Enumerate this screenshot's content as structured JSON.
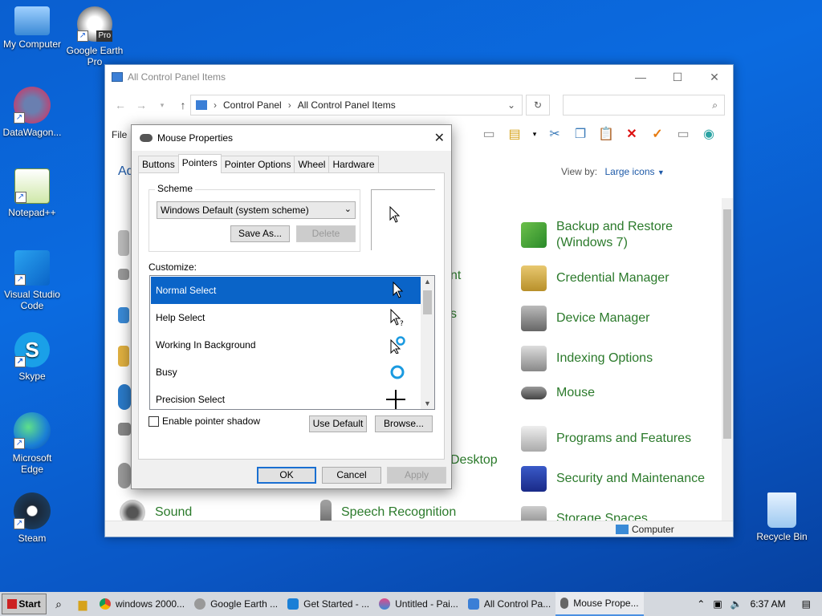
{
  "desktop": {
    "icons": [
      {
        "label": "My Computer"
      },
      {
        "label": "Google Earth Pro"
      },
      {
        "label": "DataWagon..."
      },
      {
        "label": "Notepad++"
      },
      {
        "label": "Visual Studio Code"
      },
      {
        "label": "Skype"
      },
      {
        "label": "Microsoft Edge"
      },
      {
        "label": "Steam"
      },
      {
        "label": "Recycle Bin"
      }
    ],
    "google_earth_badge": "Pro"
  },
  "control_panel": {
    "title": "All Control Panel Items",
    "breadcrumb": [
      "Control Panel",
      "All Control Panel Items"
    ],
    "menu_file": "File",
    "heading_partial": "Ad",
    "view_by_label": "View by:",
    "view_by_value": "Large icons",
    "items_partial": [
      {
        "label": "nt"
      },
      {
        "label": "Desktop"
      },
      {
        "label": "Sound"
      },
      {
        "label": "Speech Recognition"
      }
    ],
    "items": [
      {
        "label": "Backup and Restore (Windows 7)"
      },
      {
        "label": "Credential Manager"
      },
      {
        "label": "Device Manager"
      },
      {
        "label": "Indexing Options"
      },
      {
        "label": "Mouse"
      },
      {
        "label": "Programs and Features"
      },
      {
        "label": "Security and Maintenance"
      },
      {
        "label": "Storage Spaces"
      }
    ],
    "status_computer": "Computer"
  },
  "mouse_dialog": {
    "title": "Mouse Properties",
    "tabs": [
      "Buttons",
      "Pointers",
      "Pointer Options",
      "Wheel",
      "Hardware"
    ],
    "active_tab": "Pointers",
    "scheme_label": "Scheme",
    "scheme_value": "Windows Default (system scheme)",
    "save_as": "Save As...",
    "delete": "Delete",
    "customize_label": "Customize:",
    "pointers": [
      {
        "label": "Normal Select"
      },
      {
        "label": "Help Select"
      },
      {
        "label": "Working In Background"
      },
      {
        "label": "Busy"
      },
      {
        "label": "Precision Select"
      }
    ],
    "selected_pointer": "Normal Select",
    "enable_shadow": "Enable pointer shadow",
    "use_default": "Use Default",
    "browse": "Browse...",
    "ok": "OK",
    "cancel": "Cancel",
    "apply": "Apply"
  },
  "taskbar": {
    "start": "Start",
    "apps": [
      {
        "label": "windows 2000..."
      },
      {
        "label": "Google Earth ..."
      },
      {
        "label": "Get Started - ..."
      },
      {
        "label": "Untitled - Pai..."
      },
      {
        "label": "All Control Pa..."
      },
      {
        "label": "Mouse Prope..."
      }
    ],
    "clock": "6:37 AM"
  }
}
